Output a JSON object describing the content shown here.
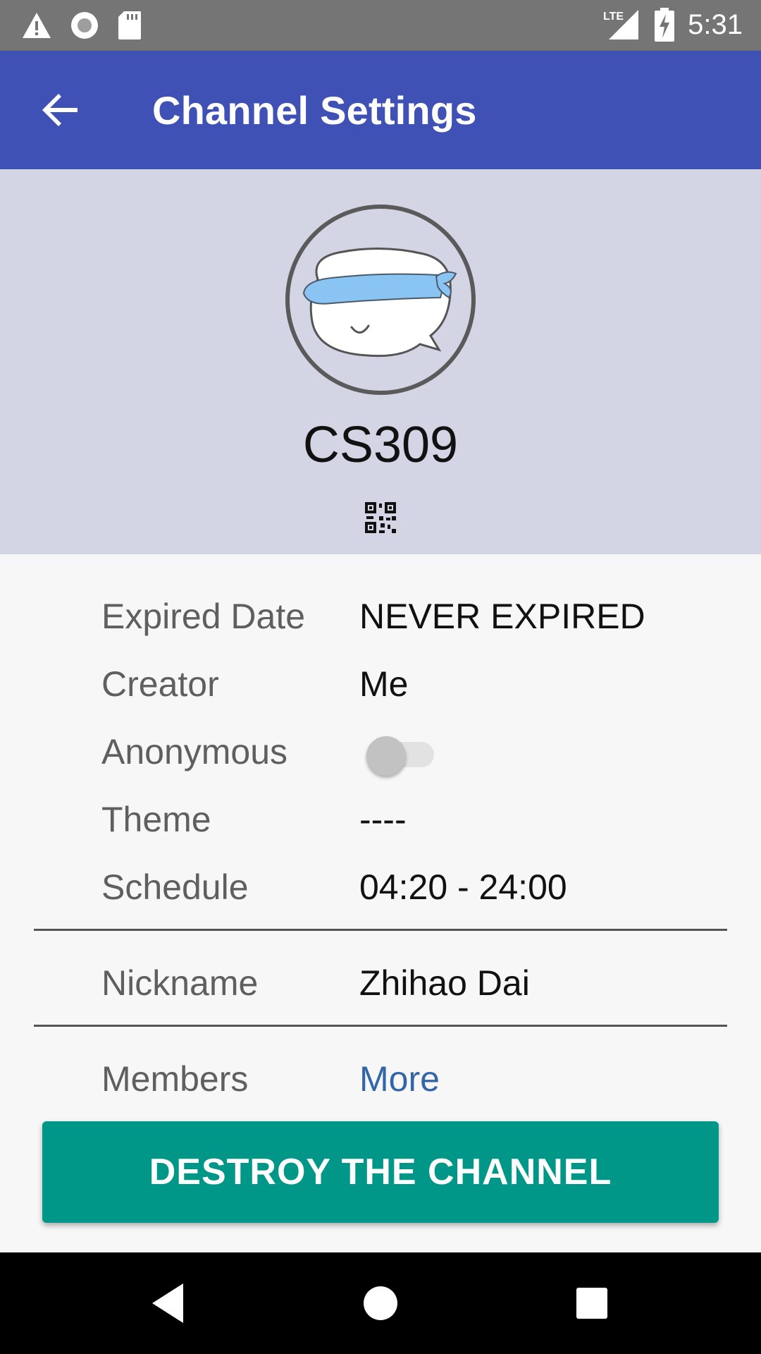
{
  "status_bar": {
    "time": "5:31",
    "network": "LTE",
    "icons": [
      "warning-icon",
      "circle-icon",
      "sd-card-icon",
      "signal-icon",
      "battery-charging-icon"
    ]
  },
  "app_bar": {
    "title": "Channel Settings",
    "back_icon": "arrow-back-icon"
  },
  "channel": {
    "name": "CS309",
    "avatar_icon": "blindfolded-chat-bubble-avatar",
    "qr_icon": "qr-code-icon"
  },
  "details": {
    "expired_date": {
      "label": "Expired Date",
      "value": "NEVER EXPIRED"
    },
    "creator": {
      "label": "Creator",
      "value": "Me"
    },
    "anonymous": {
      "label": "Anonymous",
      "enabled": false
    },
    "theme": {
      "label": "Theme",
      "value": "----"
    },
    "schedule": {
      "label": "Schedule",
      "value": "04:20 - 24:00"
    },
    "nickname": {
      "label": "Nickname",
      "value": "Zhihao Dai"
    },
    "members": {
      "label": "Members",
      "value": "More"
    }
  },
  "actions": {
    "destroy_label": "DESTROY THE CHANNEL"
  },
  "colors": {
    "app_bar": "#3f51b5",
    "header_panel": "#d3d4e4",
    "destroy_button": "#009688",
    "link": "#3366a8"
  },
  "nav_bar": {
    "icons": [
      "back-triangle-icon",
      "home-circle-icon",
      "recents-square-icon"
    ]
  }
}
